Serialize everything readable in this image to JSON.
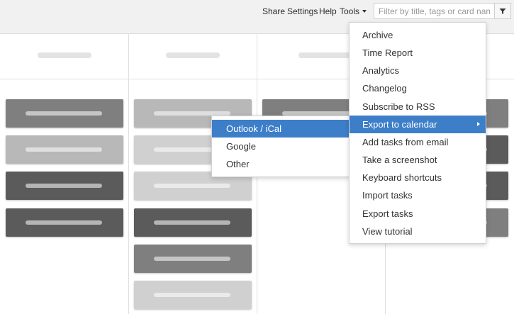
{
  "header": {
    "links": {
      "share": "Share",
      "settings": "Settings",
      "help": "Help",
      "tools": "Tools"
    },
    "search": {
      "placeholder": "Filter by title, tags or card name",
      "value": ""
    },
    "filter_icon": "funnel-icon"
  },
  "board": {
    "columns": [
      {
        "cards": [
          "dark-gray",
          "light-gray",
          "charcoal",
          "charcoal"
        ]
      },
      {
        "cards": [
          "light-gray",
          "pale-gray",
          "pale-gray",
          "charcoal",
          "dark-gray",
          "pale-gray"
        ]
      },
      {
        "cards": [
          "dark-gray"
        ]
      },
      {
        "cards": [
          "dark-gray",
          "charcoal",
          "charcoal",
          "dark-gray"
        ]
      }
    ]
  },
  "tools_menu": {
    "items": [
      {
        "label": "Archive"
      },
      {
        "label": "Time Report"
      },
      {
        "label": "Analytics"
      },
      {
        "label": "Changelog"
      },
      {
        "label": "Subscribe to RSS"
      },
      {
        "label": "Export to calendar",
        "active": true,
        "has_submenu": true
      },
      {
        "label": "Add tasks from email"
      },
      {
        "label": "Take a screenshot"
      },
      {
        "label": "Keyboard shortcuts"
      },
      {
        "label": "Import tasks"
      },
      {
        "label": "Export tasks"
      },
      {
        "label": "View tutorial"
      }
    ]
  },
  "calendar_submenu": {
    "items": [
      {
        "label": "Outlook / iCal",
        "active": true
      },
      {
        "label": "Google"
      },
      {
        "label": "Other"
      }
    ]
  },
  "colors": {
    "accent": "#3d7ec9",
    "header_bg": "#f1f1f1"
  }
}
